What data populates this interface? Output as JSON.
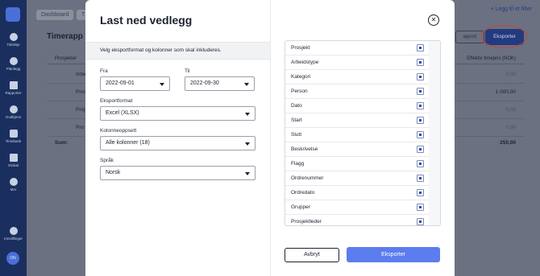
{
  "sidebar": {
    "items": [
      {
        "label": "Tidslinje"
      },
      {
        "label": "Planlegg"
      },
      {
        "label": "Rapporter"
      },
      {
        "label": "Godkjenn"
      },
      {
        "label": "Timebank"
      },
      {
        "label": "Global"
      },
      {
        "label": "Mer"
      },
      {
        "label": "Innstillinger"
      }
    ],
    "avatar_initials": "ON"
  },
  "background": {
    "tabs": [
      "Dashboard",
      "T"
    ],
    "title": "Timerapp",
    "add_link": "+ Legg til et filter",
    "report_button": "apport",
    "export_button": "Eksporter",
    "table": {
      "col_project": "Prosjekter",
      "col_price": "Effektiv timepris (NOK)",
      "rows": [
        {
          "name": "Intern",
          "value": "0,00"
        },
        {
          "name": "Pros",
          "value": "1 000,00"
        },
        {
          "name": "Proj",
          "value": "0,00"
        },
        {
          "name": "Pro",
          "value": "0,00"
        }
      ],
      "sum_label": "Sum:",
      "sum_value": "250,00"
    }
  },
  "modal": {
    "title": "Last ned vedlegg",
    "info": "Velg eksportformat og kolonner som skal inkluderes.",
    "from_label": "Fra",
    "from_value": "2022-09-01",
    "to_label": "Til",
    "to_value": "2022-09-30",
    "format_label": "Eksportformat",
    "format_value": "Excel (XLSX)",
    "columns_label": "Kolonneoppsett",
    "columns_value": "Alle kolonner (18)",
    "language_label": "Språk",
    "language_value": "Norsk",
    "columns": [
      "Prosjekt",
      "Arbeidstype",
      "Kategori",
      "Person",
      "Dato",
      "Start",
      "Slutt",
      "Beskrivelse",
      "Flagg",
      "Ordrenummer",
      "Ordredato",
      "Grupper",
      "Prosjektleder"
    ],
    "cancel_label": "Avbryt",
    "export_label": "Eksporter"
  },
  "colors": {
    "sidebar_bg": "#1b2f5e",
    "overlay_bg": "#6b7180",
    "primary_button": "#5b7ded",
    "highlight_circle": "#c8403c"
  }
}
